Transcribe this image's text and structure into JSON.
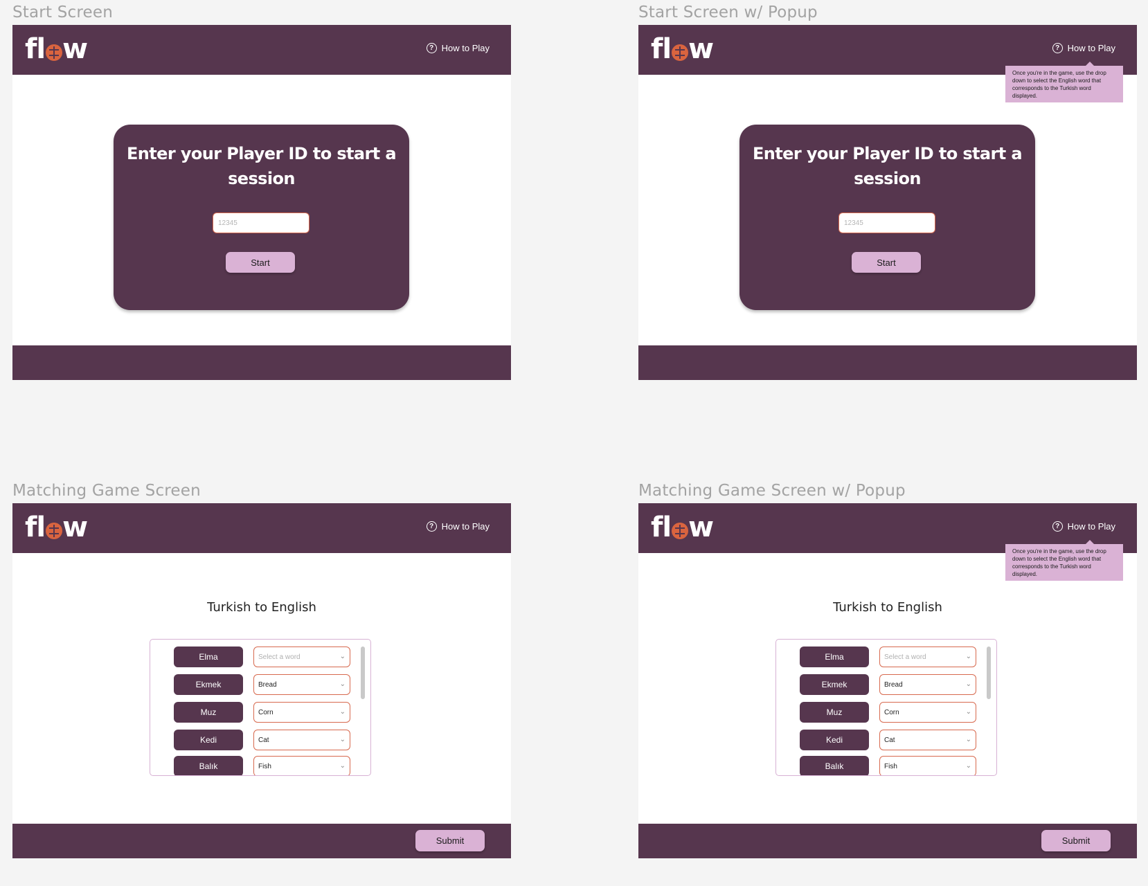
{
  "labels": {
    "start": "Start Screen",
    "start_popup": "Start Screen w/ Popup",
    "game": "Matching Game Screen",
    "game_popup": "Matching Game Screen w/ Popup"
  },
  "header": {
    "logo_prefix": "fl",
    "logo_suffix": "w",
    "logo_icon": "brain-icon",
    "how_to_play": "How to Play",
    "help_icon": "question-circle-icon"
  },
  "start": {
    "title": "Enter your Player ID to start a session",
    "input_placeholder": "12345",
    "start_label": "Start"
  },
  "popup": {
    "text": "Once you're in the game, use the drop down to select the English word that corresponds to the Turkish word displayed."
  },
  "game": {
    "title": "Turkish to English",
    "rows": [
      {
        "turkish": "Elma",
        "english": "Select a word",
        "placeholder": true
      },
      {
        "turkish": "Ekmek",
        "english": "Bread",
        "placeholder": false
      },
      {
        "turkish": "Muz",
        "english": "Corn",
        "placeholder": false
      },
      {
        "turkish": "Kedi",
        "english": "Cat",
        "placeholder": false
      },
      {
        "turkish": "Balık",
        "english": "Fish",
        "placeholder": false
      }
    ],
    "submit_label": "Submit"
  },
  "colors": {
    "brand": "#56364e",
    "accent": "#dab2d5",
    "input_border": "#d7694e",
    "logo_accent": "#d9643f",
    "canvas": "#f4f4f4"
  }
}
